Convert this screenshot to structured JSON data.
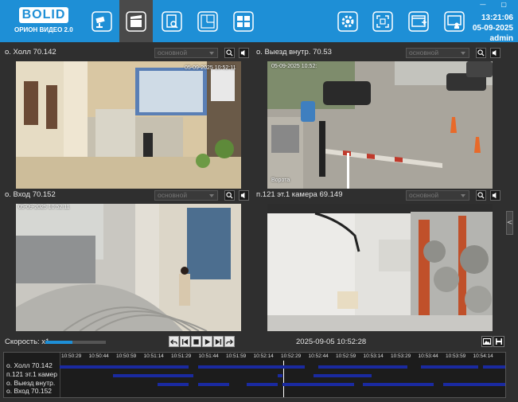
{
  "app": {
    "brand": "BOLID",
    "product": "ОРИОН ВИДЕО 2.0"
  },
  "toolbar": {
    "buttons": [
      {
        "name": "cameras-button",
        "icon": "camera-icon"
      },
      {
        "name": "archive-button",
        "icon": "clapperboard-icon",
        "active": true
      },
      {
        "name": "reports-button",
        "icon": "document-search-icon"
      },
      {
        "name": "plans-button",
        "icon": "floor-plan-icon"
      },
      {
        "name": "layouts-button",
        "icon": "grid-layout-icon"
      }
    ],
    "right_buttons": [
      {
        "name": "settings-button",
        "icon": "gear-icon"
      },
      {
        "name": "fullscreen-button",
        "icon": "expand-icon"
      },
      {
        "name": "add-window-button",
        "icon": "window-add-icon"
      },
      {
        "name": "user-monitor-button",
        "icon": "user-monitor-icon"
      }
    ]
  },
  "status": {
    "time": "13:21:06",
    "date": "05-09-2025",
    "user": "admin"
  },
  "cameras": [
    {
      "title": "о. Холл 70.142",
      "stream": "основной",
      "timestamp": "05-09-2025 10:52:11"
    },
    {
      "title": "о. Выезд внутр. 70.53",
      "stream": "основной",
      "timestamp": "05-09-2025 10:52:",
      "overlay": "Ворота"
    },
    {
      "title": "о. Вход 70.152",
      "stream": "основной",
      "timestamp": "05-09-2025 10:52:11"
    },
    {
      "title": "п.121 эт.1 камера 69.149",
      "stream": "основной",
      "timestamp": ""
    }
  ],
  "playback": {
    "speed_label": "Скорость: x1",
    "speed_level": 0.45,
    "datetime": "2025-09-05 10:52:28"
  },
  "timeline": {
    "ticks": [
      "10:50:29",
      "10:50:44",
      "10:50:59",
      "10:51:14",
      "10:51:29",
      "10:51:44",
      "10:51:59",
      "10:52:14",
      "10:52:29",
      "10:52:44",
      "10:52:59",
      "10:53:14",
      "10:53:29",
      "10:53:44",
      "10:53:59",
      "10:54:14"
    ],
    "rows": [
      {
        "label": "о. Холл 70.142",
        "segments": [
          [
            0.0,
            0.29
          ],
          [
            0.31,
            0.55
          ],
          [
            0.58,
            0.78
          ],
          [
            0.81,
            0.94
          ],
          [
            0.95,
            1.0
          ]
        ]
      },
      {
        "label": "п.121 эт.1 камер",
        "segments": [
          [
            0.12,
            0.3
          ],
          [
            0.49,
            0.5
          ],
          [
            0.57,
            0.7
          ]
        ]
      },
      {
        "label": "о. Выезд внутр.",
        "segments": [
          [
            0.22,
            0.29
          ],
          [
            0.31,
            0.38
          ],
          [
            0.42,
            0.49
          ],
          [
            0.5,
            0.66
          ],
          [
            0.68,
            0.84
          ],
          [
            0.86,
            1.0
          ]
        ]
      },
      {
        "label": "о. Вход 70.152",
        "segments": []
      }
    ],
    "cursor_position": 0.502
  },
  "colors": {
    "topbar": "#1e8fd6",
    "segment": "#1a2aa0",
    "panel_bg": "#2f2f2f"
  }
}
